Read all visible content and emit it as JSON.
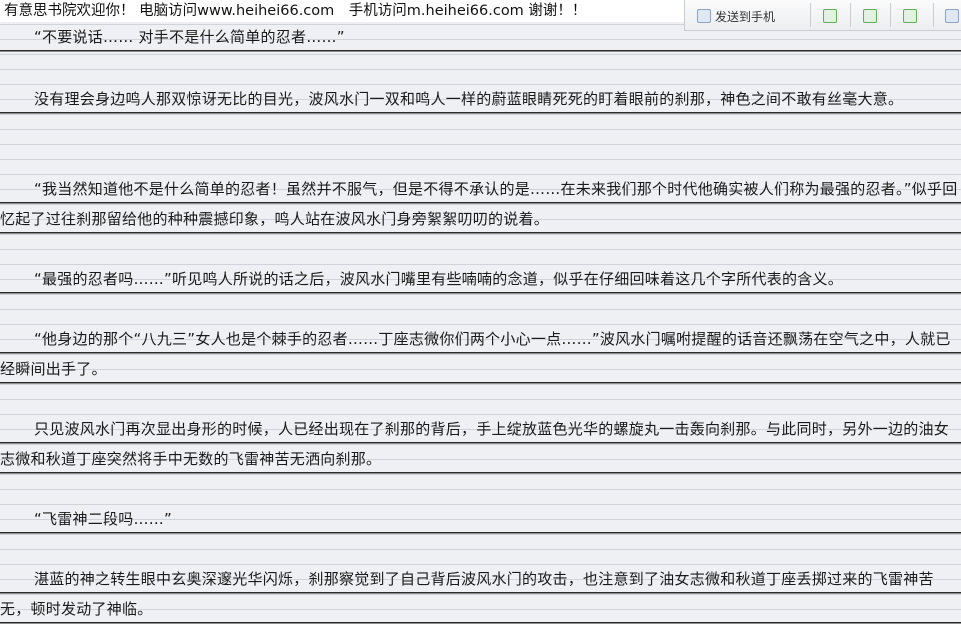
{
  "banner": {
    "text": "有意思书院欢迎你！ 电脑访问www.heihei66.com　手机访问m.heihei66.com 谢谢！！"
  },
  "toolbar": {
    "label": "发送到手机"
  },
  "paragraphs": [
    "“不要说话…… 对手不是什么简单的忍者……”",
    "没有理会身边鸣人那双惊讶无比的目光，波风水门一双和鸣人一样的蔚蓝眼睛死死的盯着眼前的刹那，神色之间不敢有丝毫大意。",
    "“我当然知道他不是什么简单的忍者！虽然并不服气，但是不得不承认的是……在未来我们那个时代他确实被人们称为最强的忍者。”似乎回忆起了过往刹那留给他的种种震撼印象，鸣人站在波风水门身旁絮絮叨叨的说着。",
    "“最强的忍者吗……”听见鸣人所说的话之后，波风水门嘴里有些喃喃的念道，似乎在仔细回味着这几个字所代表的含义。",
    "“他身边的那个“八九三”女人也是个棘手的忍者……丁座志微你们两个小心一点……”波风水门嘱咐提醒的话音还飘荡在空气之中，人就已经瞬间出手了。",
    "只见波风水门再次显出身形的时候，人已经出现在了刹那的背后，手上绽放蓝色光华的螺旋丸一击轰向刹那。与此同时，另外一边的油女志微和秋道丁座突然将手中无数的飞雷神苦无洒向刹那。",
    "“飞雷神二段吗……”",
    "湛蓝的神之转生眼中玄奥深邃光华闪烁，刹那察觉到了自己背后波风水门的攻击，也注意到了油女志微和秋道丁座丢掷过来的飞雷神苦无，顿时发动了神临。"
  ]
}
